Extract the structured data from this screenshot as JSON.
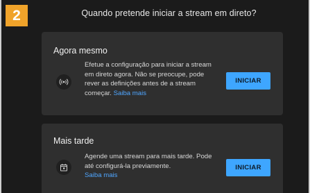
{
  "step": {
    "number": "2",
    "color": "#f0a32a"
  },
  "dialog": {
    "title": "Quando pretende iniciar a stream em direto?"
  },
  "options": [
    {
      "title": "Agora mesmo",
      "icon": "live-broadcast-icon",
      "description": "Efetue a configuração para iniciar a stream em direto agora. Não se preocupe, pode rever as definições antes de a stream começar.",
      "link": "Saiba mais",
      "button": "INICIAR"
    },
    {
      "title": "Mais tarde",
      "icon": "calendar-icon",
      "description": "Agende uma stream para mais tarde. Pode até configurá-la previamente.",
      "link": "Saiba mais",
      "button": "INICIAR"
    }
  ],
  "colors": {
    "background": "#1b1b1b",
    "card": "#2f2f2f",
    "accent": "#3ea6ff",
    "link": "#4fa6ff"
  }
}
